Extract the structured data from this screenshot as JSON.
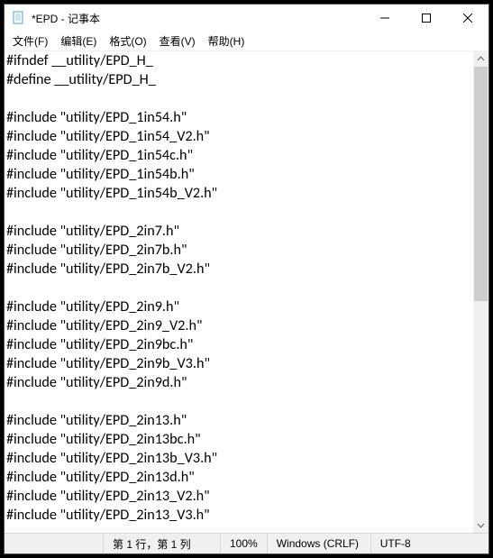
{
  "window": {
    "title": "*EPD - 记事本"
  },
  "menu": {
    "file": "文件(F)",
    "edit": "编辑(E)",
    "format": "格式(O)",
    "view": "查看(V)",
    "help": "帮助(H)"
  },
  "editor": {
    "lines": [
      "#ifndef __utility/EPD_H_",
      "#define __utility/EPD_H_",
      "",
      "#include \"utility/EPD_1in54.h\"",
      "#include \"utility/EPD_1in54_V2.h\"",
      "#include \"utility/EPD_1in54c.h\"",
      "#include \"utility/EPD_1in54b.h\"",
      "#include \"utility/EPD_1in54b_V2.h\"",
      "",
      "#include \"utility/EPD_2in7.h\"",
      "#include \"utility/EPD_2in7b.h\"",
      "#include \"utility/EPD_2in7b_V2.h\"",
      "",
      "#include \"utility/EPD_2in9.h\"",
      "#include \"utility/EPD_2in9_V2.h\"",
      "#include \"utility/EPD_2in9bc.h\"",
      "#include \"utility/EPD_2in9b_V3.h\"",
      "#include \"utility/EPD_2in9d.h\"",
      "",
      "#include \"utility/EPD_2in13.h\"",
      "#include \"utility/EPD_2in13bc.h\"",
      "#include \"utility/EPD_2in13b_V3.h\"",
      "#include \"utility/EPD_2in13d.h\"",
      "#include \"utility/EPD_2in13_V2.h\"",
      "#include \"utility/EPD_2in13_V3.h\""
    ]
  },
  "status": {
    "position": "第 1 行，第 1 列",
    "zoom": "100%",
    "eol": "Windows (CRLF)",
    "encoding": "UTF-8"
  }
}
